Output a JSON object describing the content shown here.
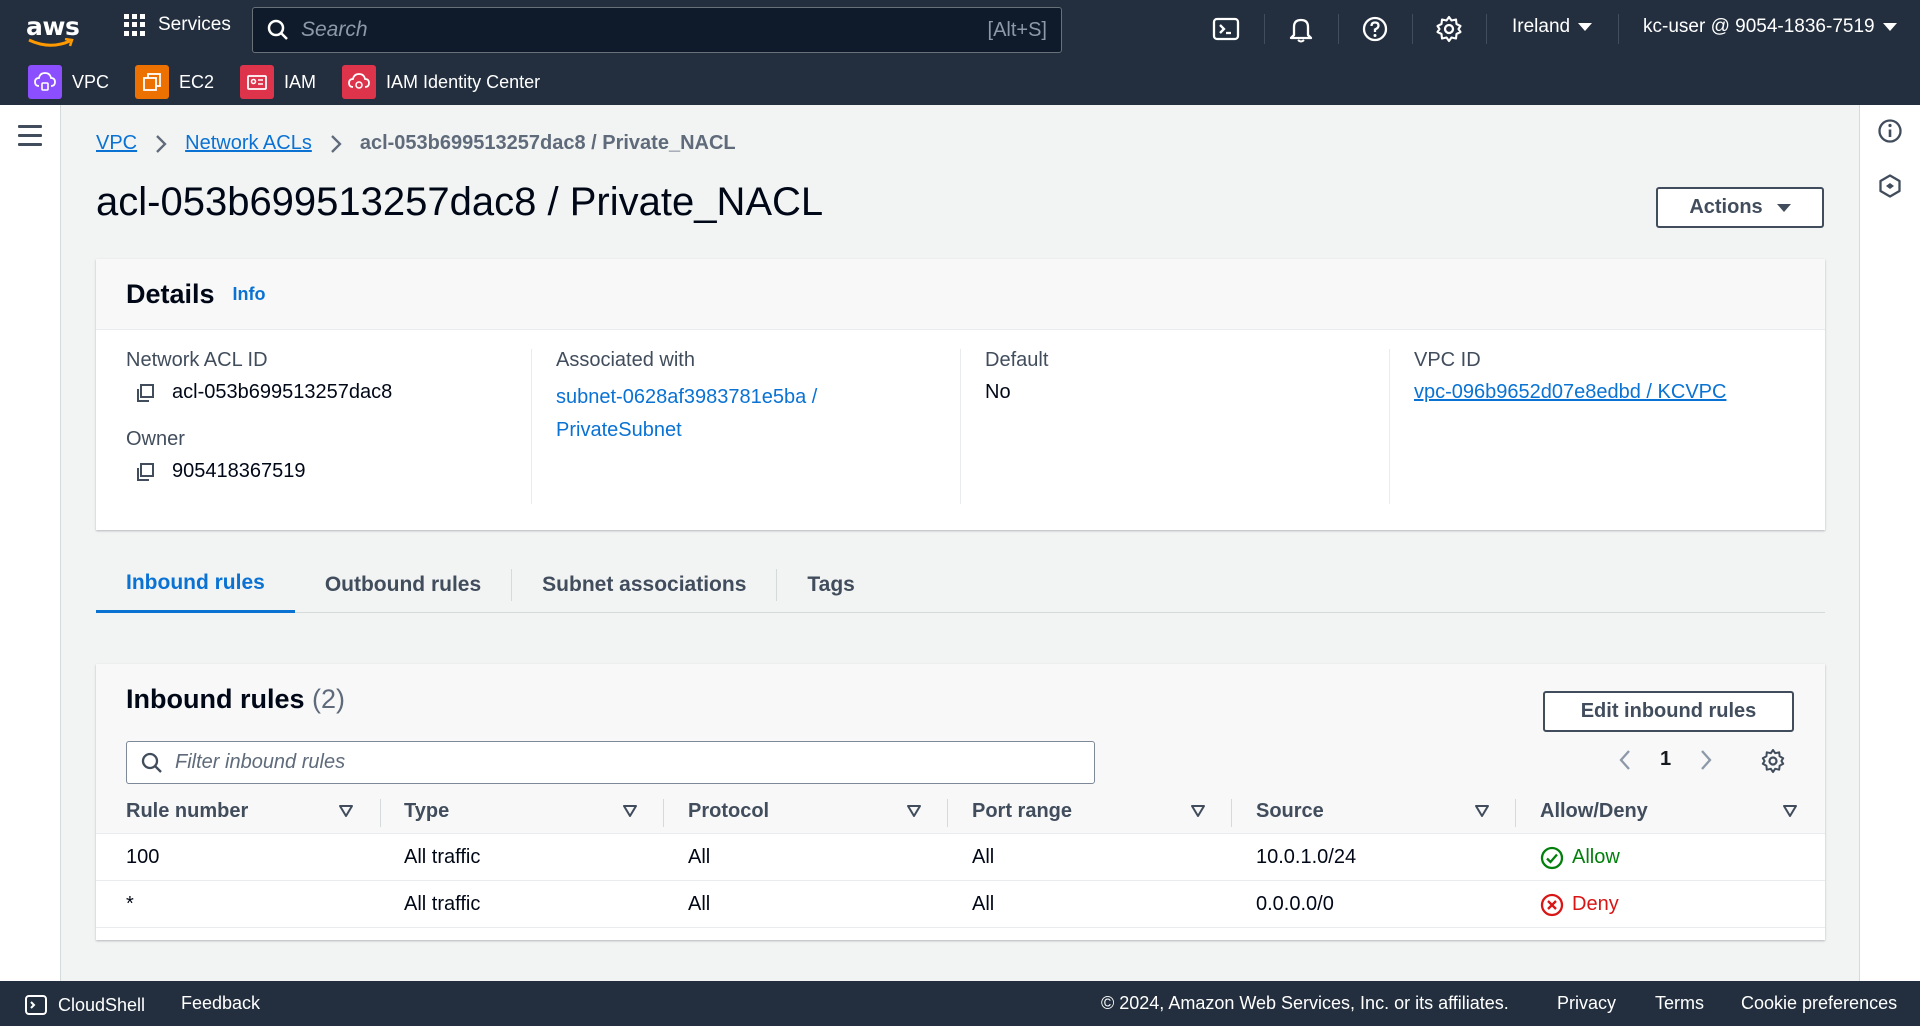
{
  "topnav": {
    "logo_text": "aws",
    "services_label": "Services",
    "search_placeholder": "Search",
    "search_shortcut": "[Alt+S]",
    "region": "Ireland",
    "account": "kc-user @ 9054-1836-7519"
  },
  "favorites": [
    {
      "label": "VPC",
      "color": "#8c4fff"
    },
    {
      "label": "EC2",
      "color": "#ed7100"
    },
    {
      "label": "IAM",
      "color": "#dd344c"
    },
    {
      "label": "IAM Identity Center",
      "color": "#dd344c"
    }
  ],
  "breadcrumb": {
    "items": [
      "VPC",
      "Network ACLs"
    ],
    "current": "acl-053b699513257dac8 / Private_NACL"
  },
  "page": {
    "title": "acl-053b699513257dac8 / Private_NACL",
    "actions_label": "Actions"
  },
  "details": {
    "title": "Details",
    "info": "Info",
    "acl_id_label": "Network ACL ID",
    "acl_id": "acl-053b699513257dac8",
    "owner_label": "Owner",
    "owner": "905418367519",
    "associated_label": "Associated with",
    "associated_line1": "subnet-0628af3983781e5ba /",
    "associated_line2": "PrivateSubnet",
    "default_label": "Default",
    "default_value": "No",
    "vpc_label": "VPC ID",
    "vpc_value": "vpc-096b9652d07e8edbd / KCVPC"
  },
  "tabs": [
    "Inbound rules",
    "Outbound rules",
    "Subnet associations",
    "Tags"
  ],
  "rules": {
    "title": "Inbound rules",
    "count": "(2)",
    "edit_label": "Edit inbound rules",
    "filter_placeholder": "Filter inbound rules",
    "page": "1",
    "columns": [
      "Rule number",
      "Type",
      "Protocol",
      "Port range",
      "Source",
      "Allow/Deny"
    ],
    "rows": [
      [
        "100",
        "All traffic",
        "All",
        "All",
        "10.0.1.0/24",
        "Allow"
      ],
      [
        "*",
        "All traffic",
        "All",
        "All",
        "0.0.0.0/0",
        "Deny"
      ]
    ]
  },
  "footer": {
    "cloudshell": "CloudShell",
    "feedback": "Feedback",
    "copyright": "© 2024, Amazon Web Services, Inc. or its affiliates.",
    "privacy": "Privacy",
    "terms": "Terms",
    "cookies": "Cookie preferences"
  }
}
